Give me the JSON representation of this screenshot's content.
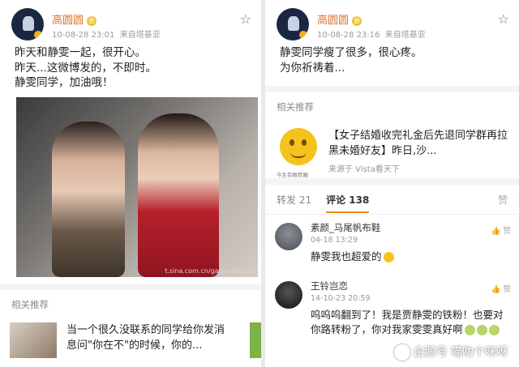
{
  "left": {
    "post": {
      "user": "高圆圆",
      "badge": "会",
      "time": "10-08-28 23:01",
      "source": "来自塔基亚",
      "lines": [
        "昨天和静雯一起，很开心。",
        "昨天...这微博发的，不即时。",
        "静雯同学，加油哦！"
      ],
      "photo_watermark": "t.sina.com.cn/gaoyuanyuan"
    },
    "related": {
      "title": "相关推荐",
      "item_text": "当一个很久没联系的同学给你发消息问\"你在不\"的时候，你的..."
    }
  },
  "right": {
    "post": {
      "user": "高圆圆",
      "badge": "会",
      "time": "10-08-28 23:16",
      "source": "来自塔基亚",
      "lines": [
        "静雯同学瘦了很多，很心疼。",
        "为你祈祷着..."
      ]
    },
    "related": {
      "title": "相关推荐",
      "item_title": "【女子结婚收完礼金后先退同学群再拉黑未婚好友】昨日,沙...",
      "item_source": "来源于 Vista看天下",
      "emoji_caption": "今生有推荐圈"
    },
    "tabs": {
      "repost": "转发 21",
      "comments": "评论 138",
      "right": "赞"
    },
    "comments": [
      {
        "name": "素颜_马尾帆布鞋",
        "time": "04-18 13:29",
        "body": "静雯我也超爱的",
        "likes": "赞"
      },
      {
        "name": "王铃岂恋",
        "time": "14-10-23 20:59",
        "body": "呜呜呜翻到了！我是贾静雯的铁粉！也要对你路转粉了，你对我家雯雯真好啊",
        "likes": "赞"
      }
    ],
    "watermark": "企鹅号 喵叻个咪呀"
  }
}
